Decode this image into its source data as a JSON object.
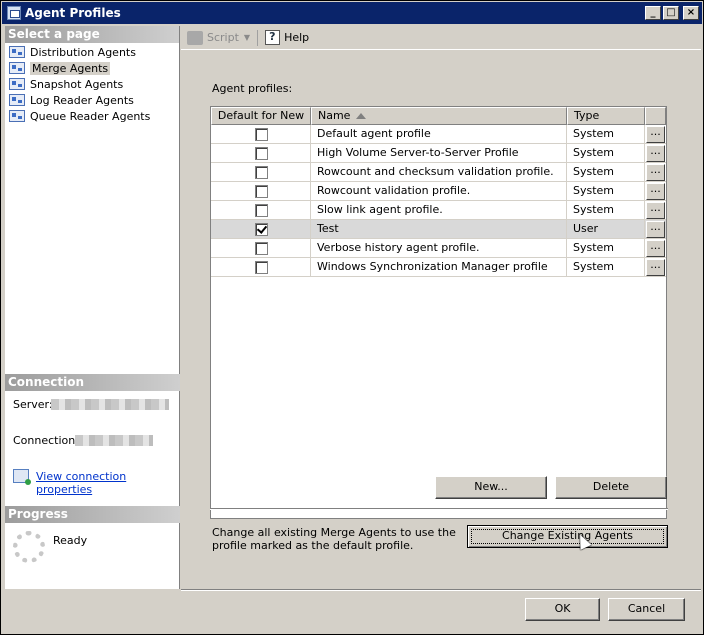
{
  "window": {
    "title": "Agent Profiles"
  },
  "sidebar": {
    "header": "Select a page",
    "items": [
      {
        "label": "Distribution Agents",
        "selected": false
      },
      {
        "label": "Merge Agents",
        "selected": true
      },
      {
        "label": "Snapshot Agents",
        "selected": false
      },
      {
        "label": "Log Reader Agents",
        "selected": false
      },
      {
        "label": "Queue Reader Agents",
        "selected": false
      }
    ]
  },
  "connection": {
    "header": "Connection",
    "server_label": "Server:",
    "connection_label": "Connection:",
    "view_link": "View connection properties"
  },
  "progress": {
    "header": "Progress",
    "status": "Ready"
  },
  "toolbar": {
    "script_label": "Script",
    "help_label": "Help"
  },
  "main": {
    "profiles_label": "Agent profiles:",
    "columns": {
      "default": "Default for New",
      "name": "Name",
      "type": "Type"
    },
    "rows": [
      {
        "default": false,
        "name": "Default agent profile",
        "type": "System"
      },
      {
        "default": false,
        "name": "High Volume Server-to-Server Profile",
        "type": "System"
      },
      {
        "default": false,
        "name": "Rowcount and checksum validation profile.",
        "type": "System"
      },
      {
        "default": false,
        "name": "Rowcount validation profile.",
        "type": "System"
      },
      {
        "default": false,
        "name": "Slow link agent profile.",
        "type": "System"
      },
      {
        "default": true,
        "name": "Test",
        "type": "User",
        "selected": true
      },
      {
        "default": false,
        "name": "Verbose history agent profile.",
        "type": "System"
      },
      {
        "default": false,
        "name": "Windows Synchronization Manager profile",
        "type": "System"
      }
    ],
    "ellipsis": "...",
    "new_label": "New...",
    "delete_label": "Delete",
    "change_text": "Change all existing Merge Agents to use the profile marked as the default profile.",
    "change_label": "Change Existing Agents"
  },
  "footer": {
    "ok_label": "OK",
    "cancel_label": "Cancel"
  }
}
